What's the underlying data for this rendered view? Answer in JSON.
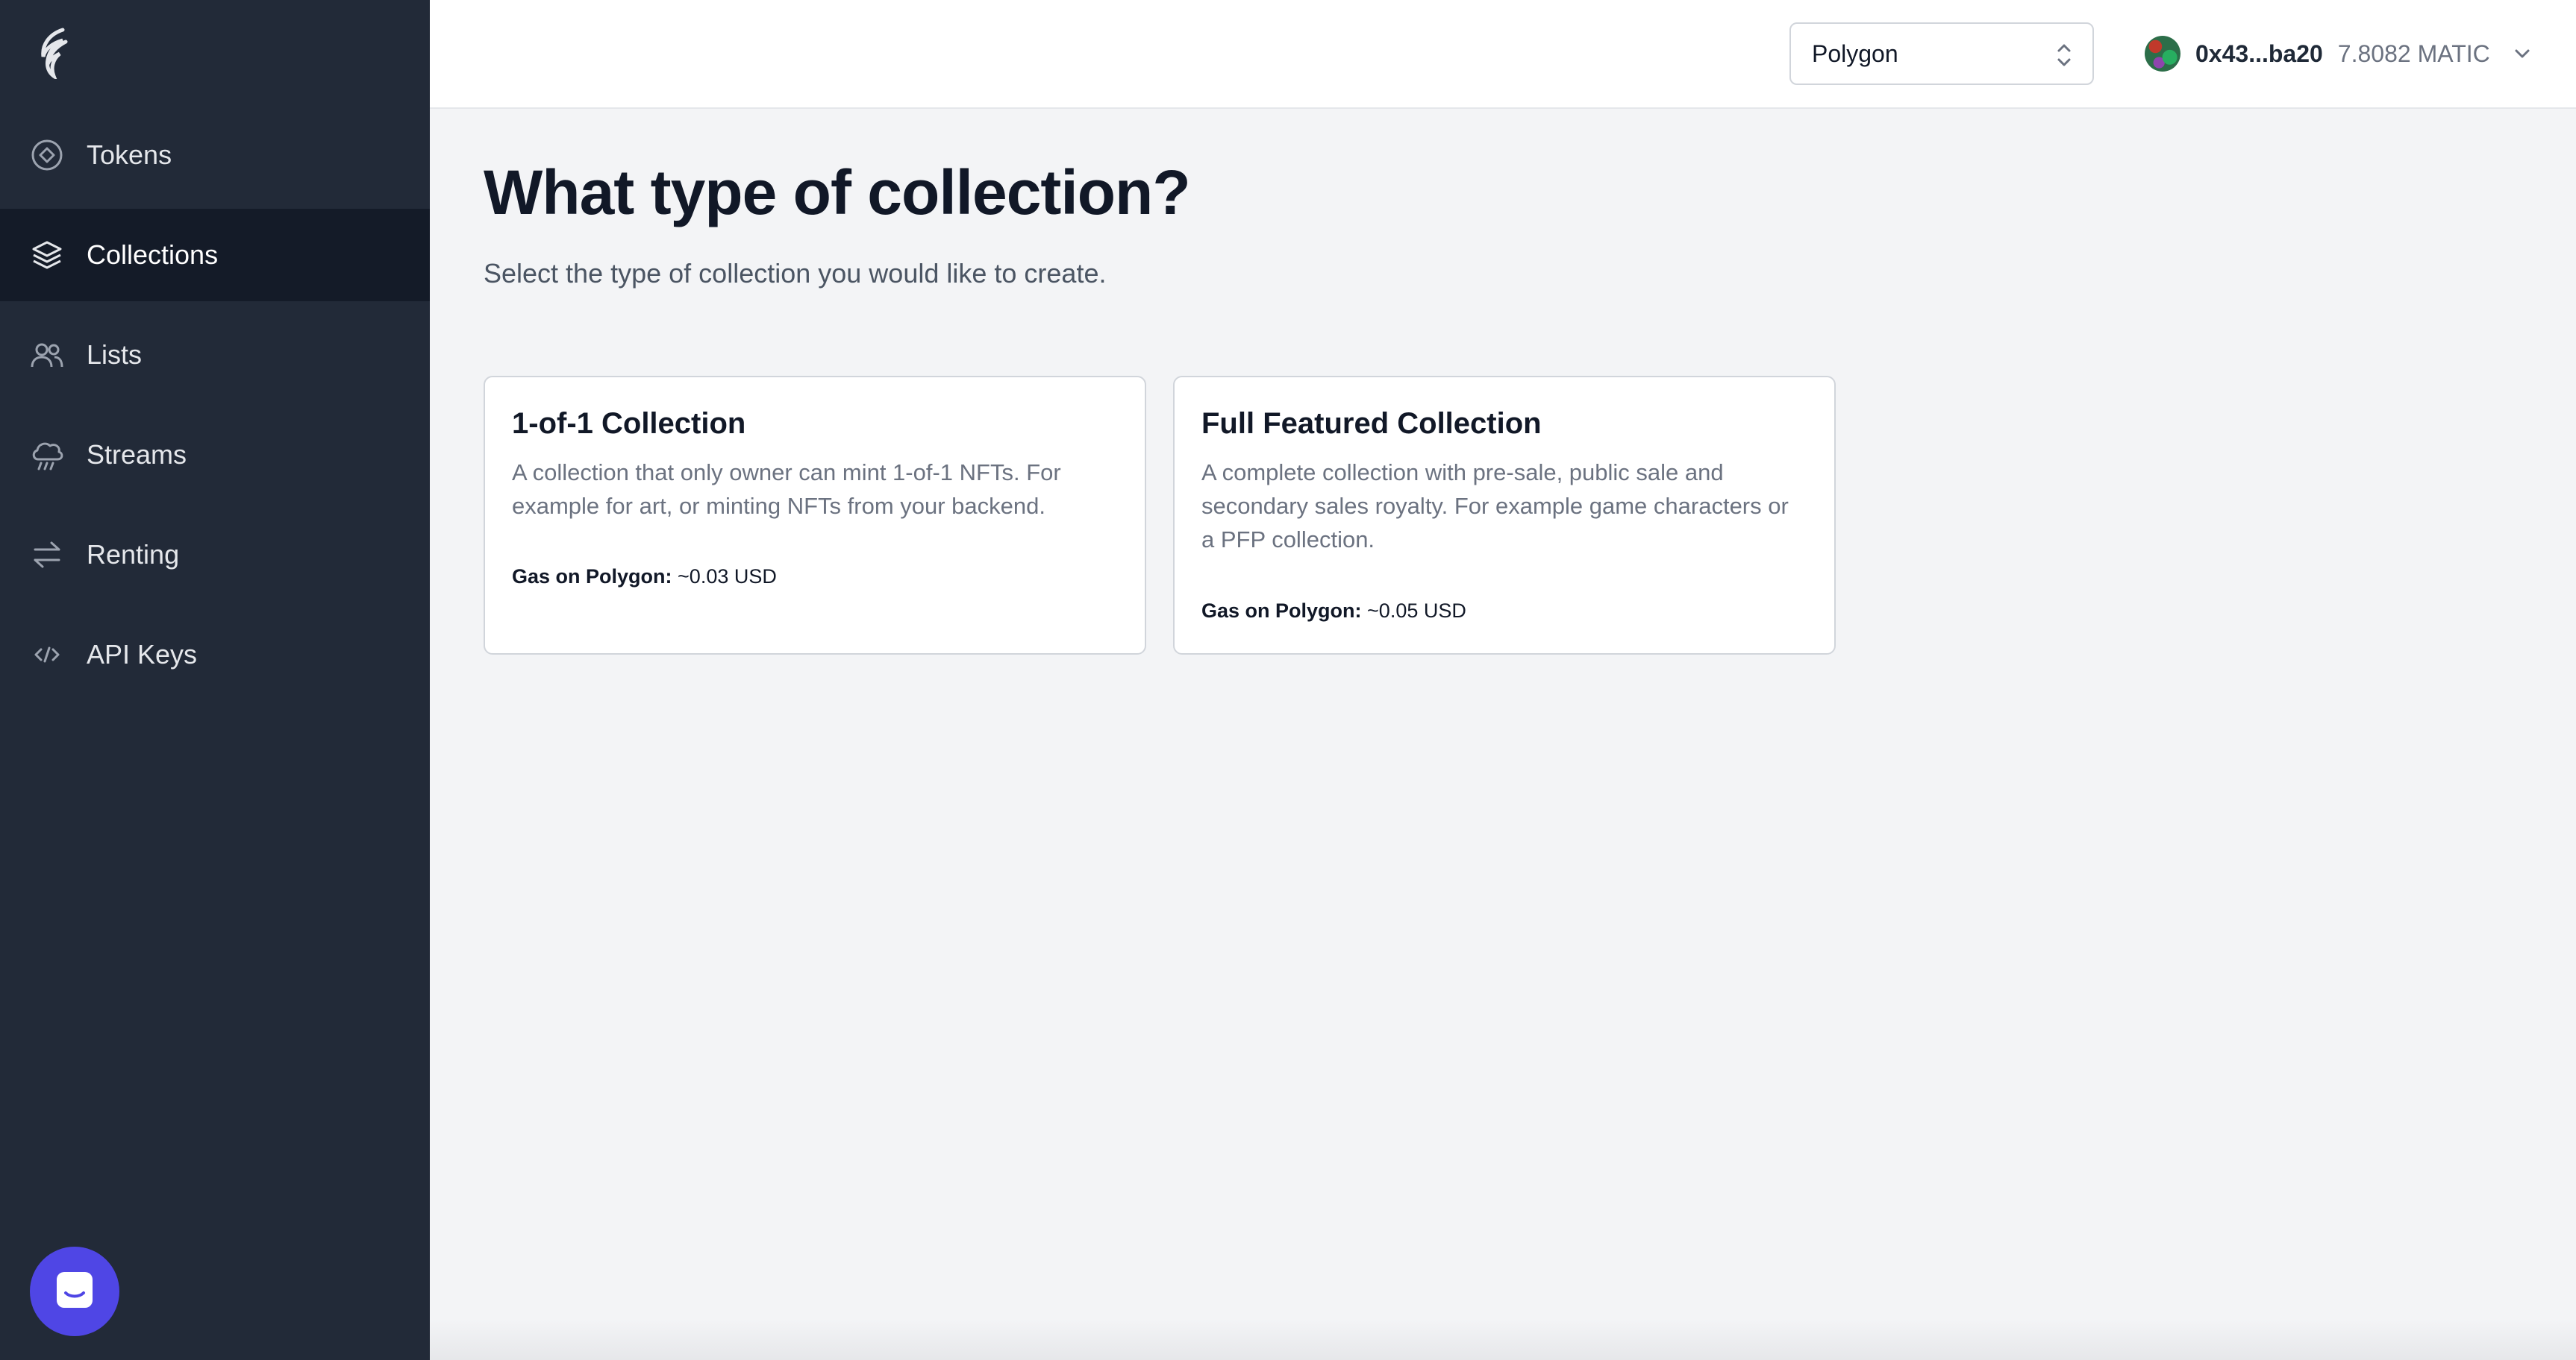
{
  "sidebar": {
    "items": [
      {
        "label": "Tokens",
        "icon": "token-icon",
        "active": false
      },
      {
        "label": "Collections",
        "icon": "layers-icon",
        "active": true
      },
      {
        "label": "Lists",
        "icon": "users-icon",
        "active": false
      },
      {
        "label": "Streams",
        "icon": "cloud-rain-icon",
        "active": false
      },
      {
        "label": "Renting",
        "icon": "arrows-swap-icon",
        "active": false
      },
      {
        "label": "API Keys",
        "icon": "code-icon",
        "active": false
      }
    ],
    "chat_icon": "chat-bubble-icon"
  },
  "header": {
    "network": {
      "selected": "Polygon"
    },
    "account": {
      "address": "0x43...ba20",
      "balance": "7.8082 MATIC"
    }
  },
  "main": {
    "title": "What type of collection?",
    "subtitle": "Select the type of collection you would like to create.",
    "cards": [
      {
        "title": "1-of-1 Collection",
        "description": "A collection that only owner can mint 1-of-1 NFTs. For example for art, or minting NFTs from your backend.",
        "gas_label": "Gas on Polygon:",
        "gas_value": "~0.03 USD"
      },
      {
        "title": "Full Featured Collection",
        "description": "A complete collection with pre-sale, public sale and secondary sales royalty. For example game characters or a PFP collection.",
        "gas_label": "Gas on Polygon:",
        "gas_value": "~0.05 USD"
      }
    ]
  },
  "colors": {
    "sidebar_bg": "#222a38",
    "sidebar_active": "#141b28",
    "accent": "#4f46e5",
    "page_bg": "#f3f4f6"
  }
}
